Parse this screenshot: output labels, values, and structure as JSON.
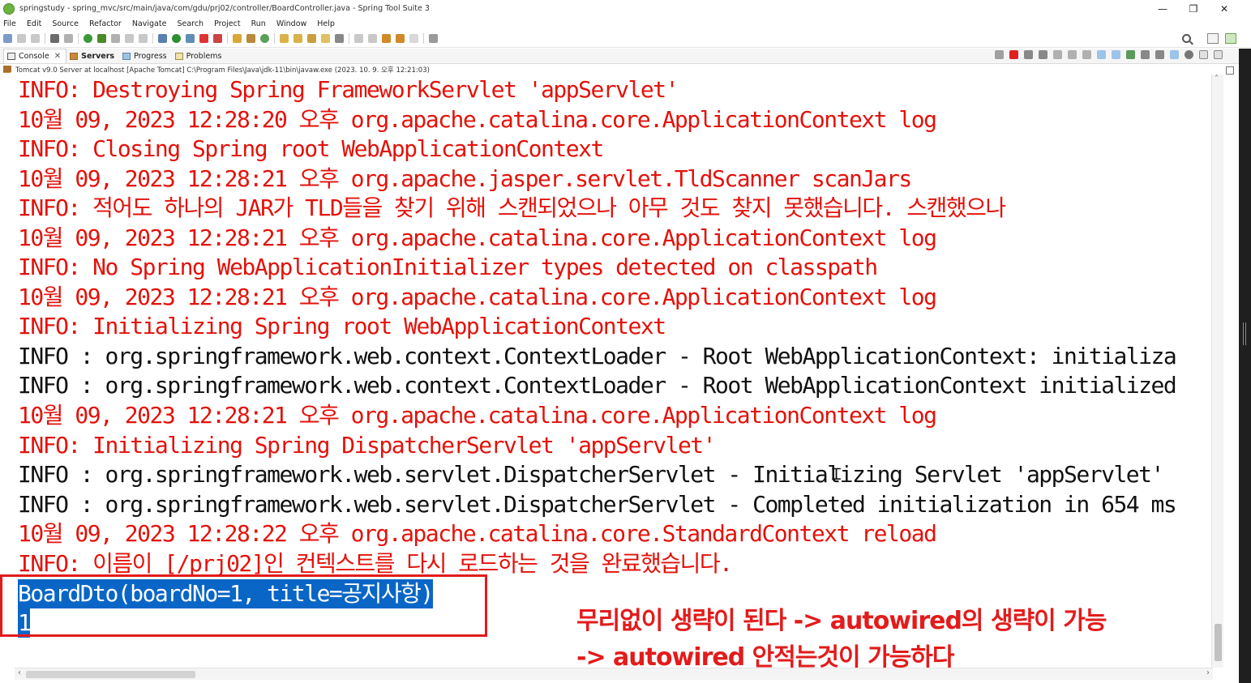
{
  "window": {
    "title": "springstudy - spring_mvc/src/main/java/com/gdu/prj02/controller/BoardController.java - Spring Tool Suite 3",
    "minimize": "—",
    "maximize": "❐",
    "close": "✕"
  },
  "menu": [
    "File",
    "Edit",
    "Source",
    "Refactor",
    "Navigate",
    "Search",
    "Project",
    "Run",
    "Window",
    "Help"
  ],
  "view_tabs": {
    "console": "Console",
    "servers": "Servers",
    "progress": "Progress",
    "problems": "Problems"
  },
  "console_desc": "Tomcat v9.0 Server at localhost [Apache Tomcat] C:\\Program Files\\Java\\jdk-11\\bin\\javaw.exe  (2023. 10. 9. 오후 12:21:03)",
  "console_lines": [
    {
      "text": "INFO: Destroying Spring FrameworkServlet 'appServlet'",
      "color": "red"
    },
    {
      "text": "10월 09, 2023 12:28:20 오후 org.apache.catalina.core.ApplicationContext log",
      "color": "red"
    },
    {
      "text": "INFO: Closing Spring root WebApplicationContext",
      "color": "red"
    },
    {
      "text": "10월 09, 2023 12:28:21 오후 org.apache.jasper.servlet.TldScanner scanJars",
      "color": "red"
    },
    {
      "text": "INFO: 적어도 하나의 JAR가 TLD들을 찾기 위해 스캔되었으나 아무 것도 찾지 못했습니다. 스캔했으나",
      "color": "red"
    },
    {
      "text": "10월 09, 2023 12:28:21 오후 org.apache.catalina.core.ApplicationContext log",
      "color": "red"
    },
    {
      "text": "INFO: No Spring WebApplicationInitializer types detected on classpath",
      "color": "red"
    },
    {
      "text": "10월 09, 2023 12:28:21 오후 org.apache.catalina.core.ApplicationContext log",
      "color": "red"
    },
    {
      "text": "INFO: Initializing Spring root WebApplicationContext",
      "color": "red"
    },
    {
      "text": "INFO : org.springframework.web.context.ContextLoader - Root WebApplicationContext: initializa",
      "color": "black"
    },
    {
      "text": "INFO : org.springframework.web.context.ContextLoader - Root WebApplicationContext initialized",
      "color": "black"
    },
    {
      "text": "10월 09, 2023 12:28:21 오후 org.apache.catalina.core.ApplicationContext log",
      "color": "red"
    },
    {
      "text": "INFO: Initializing Spring DispatcherServlet 'appServlet'",
      "color": "red"
    },
    {
      "text": "INFO : org.springframework.web.servlet.DispatcherServlet - Initializing Servlet 'appServlet'",
      "color": "black"
    },
    {
      "text": "INFO : org.springframework.web.servlet.DispatcherServlet - Completed initialization in 654 ms",
      "color": "black"
    },
    {
      "text": "10월 09, 2023 12:28:22 오후 org.apache.catalina.core.StandardContext reload",
      "color": "red"
    },
    {
      "text": "INFO: 이름이 [/prj02]인 컨텍스트를 다시 로드하는 것을 완료했습니다.",
      "color": "red"
    },
    {
      "text": "BoardDto(boardNo=1, title=공지사항)",
      "color": "selected"
    },
    {
      "text": "1",
      "color": "selected"
    }
  ],
  "annotation": {
    "line1": "무리없이 생략이 된다 -> autowired의 생략이 가능",
    "line2": "-> autowired 안적는것이 가능하다",
    "color": "#e31b1b"
  },
  "colors": {
    "log_red": "#e3120b",
    "log_black": "#111111",
    "selection": "#0a66c6"
  }
}
